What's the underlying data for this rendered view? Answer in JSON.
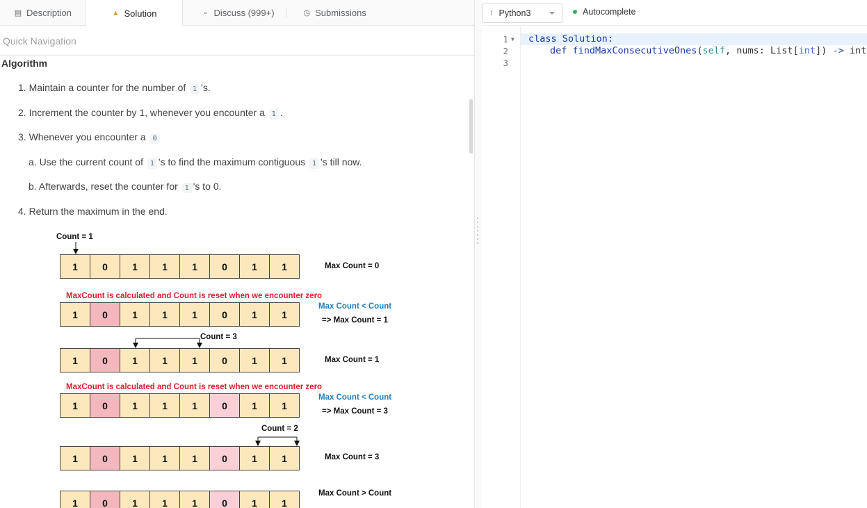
{
  "tabs": [
    {
      "label": "Description",
      "icon": "document-icon"
    },
    {
      "label": "Solution",
      "icon": "flask-icon"
    },
    {
      "label": "Discuss (999+)",
      "icon": "chat-icon"
    },
    {
      "label": "Submissions",
      "icon": "clock-icon"
    }
  ],
  "quick_nav": "Quick Navigation",
  "algorithm": {
    "title": "Algorithm",
    "s1_pre": "1. Maintain a counter for the number of",
    "s1_code": "1",
    "s1_post": "'s.",
    "s2_pre": "2. Increment the counter by 1, whenever you encounter a",
    "s2_code": "1",
    "s2_post": ".",
    "s3_pre": "3. Whenever you encounter a",
    "s3_code": "0",
    "s3a_pre": "a. Use the current count of",
    "s3a_code": "1",
    "s3a_mid": "'s to find the maximum contiguous",
    "s3a_code2": "1",
    "s3a_post": "'s till now.",
    "s3b_pre": "b. Afterwards, reset the counter for",
    "s3b_code": "1",
    "s3b_post": "'s to 0.",
    "s4": "4. Return the maximum in the end."
  },
  "diagram": {
    "count1": "Count = 1",
    "max0": "Max Count = 0",
    "reset_note": "MaxCount is calculated and Count is reset when we encounter zero",
    "maxlt": "Max Count < Count",
    "arrow_max1": "=> Max Count = 1",
    "count3": "Count = 3",
    "max1": "Max Count = 1",
    "reset_note2": "MaxCount is calculated and Count is reset when we encounter zero",
    "maxlt2": "Max Count < Count",
    "arrow_max3": "=> Max Count = 3",
    "count2": "Count = 2",
    "max3": "Max Count = 3",
    "maxgt": "Max Count > Count",
    "array": [
      "1",
      "0",
      "1",
      "1",
      "1",
      "0",
      "1",
      "1"
    ]
  },
  "editor": {
    "language": "Python3",
    "autocomplete": "Autocomplete",
    "line_numbers": [
      "1",
      "2",
      "3"
    ],
    "code_line2": {
      "def": "def",
      "fn": "findMaxConsecutiveOnes",
      "open": "(",
      "self": "self",
      "mid": ", nums: List[",
      "int": "int",
      "close": "]) ",
      "arrow": "->",
      "ret": " int:"
    },
    "kw_class": "class",
    "cls_name": "Solution:"
  }
}
